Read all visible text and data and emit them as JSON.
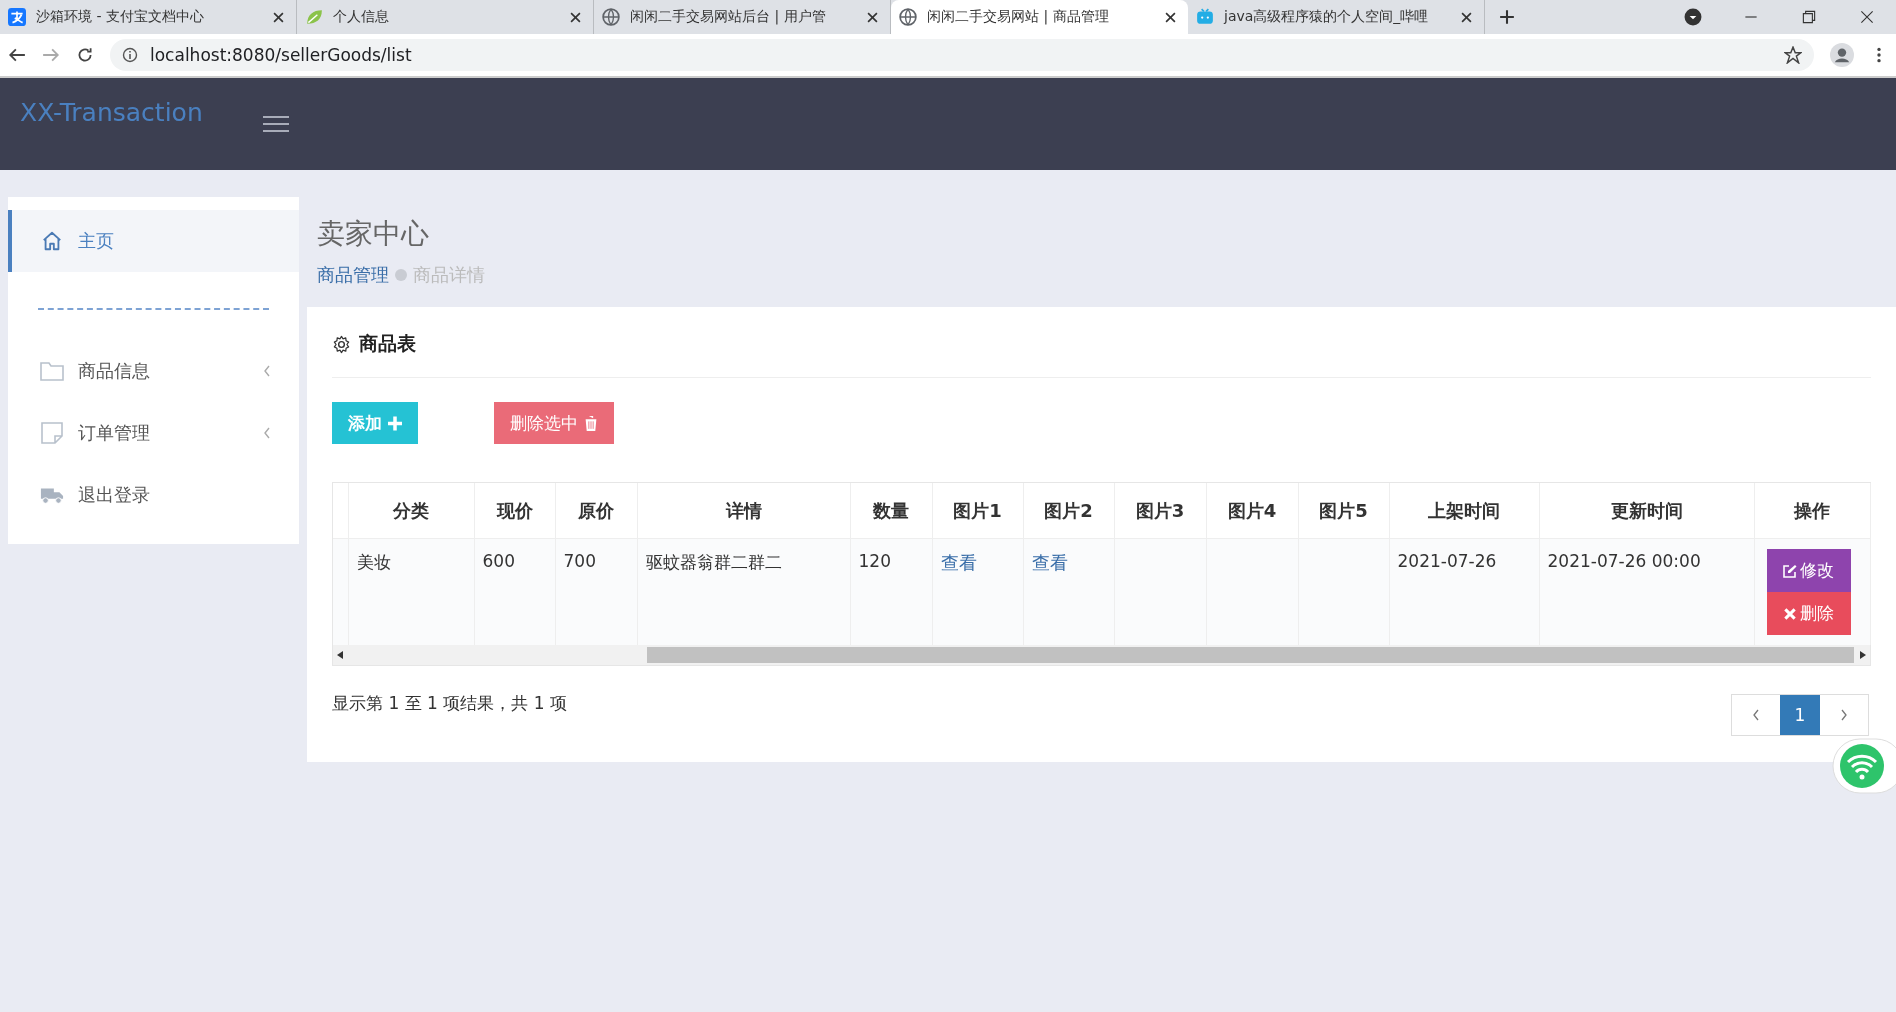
{
  "browser": {
    "tabs": [
      {
        "title": "沙箱环境 - 支付宝文档中心",
        "selected": false
      },
      {
        "title": "个人信息",
        "selected": false
      },
      {
        "title": "闲闲二手交易网站后台 | 用户管",
        "selected": false
      },
      {
        "title": "闲闲二手交易网站 | 商品管理",
        "selected": true
      },
      {
        "title": "java高级程序猿的个人空间_哔哩",
        "selected": false
      }
    ],
    "address": "localhost:8080/sellerGoods/list"
  },
  "app": {
    "brand": "XX-Transaction"
  },
  "sidebar": {
    "items": [
      {
        "label": "主页",
        "kind": "link",
        "selected": true
      },
      {
        "kind": "divider"
      },
      {
        "label": "商品信息",
        "kind": "menu",
        "expanded": false,
        "selected": false
      },
      {
        "label": "订单管理",
        "kind": "menu",
        "expanded": false,
        "selected": false
      },
      {
        "label": "退出登录",
        "kind": "link",
        "selected": false
      }
    ]
  },
  "page": {
    "title": "卖家中心",
    "breadcrumb": [
      {
        "label": "商品管理",
        "kind": "link"
      },
      {
        "label": "商品详情",
        "kind": "current"
      }
    ]
  },
  "card": {
    "title": "商品表",
    "buttons": [
      {
        "label": "添加",
        "kind": "add"
      },
      {
        "label": "删除选中",
        "kind": "delete"
      }
    ],
    "table": {
      "columns": [
        "分类",
        "现价",
        "原价",
        "详情",
        "数量",
        "图片1",
        "图片2",
        "图片3",
        "图片4",
        "图片5",
        "上架时间",
        "更新时间",
        "操作"
      ],
      "rows": [
        {
          "cells": [
            {
              "kind": "text",
              "text": "美妆"
            },
            {
              "kind": "text",
              "text": "600"
            },
            {
              "kind": "text",
              "text": "700"
            },
            {
              "kind": "text",
              "text": "驱蚊器翁群二群二"
            },
            {
              "kind": "text",
              "text": "120"
            },
            {
              "kind": "link",
              "text": "查看"
            },
            {
              "kind": "link",
              "text": "查看"
            },
            {
              "kind": "empty"
            },
            {
              "kind": "empty"
            },
            {
              "kind": "empty"
            },
            {
              "kind": "text",
              "text": "2021-07-26"
            },
            {
              "kind": "text",
              "text": "2021-07-26 00:00"
            },
            {
              "kind": "actions",
              "actions": [
                {
                  "label": "修改",
                  "kind": "edit"
                },
                {
                  "label": "删除",
                  "kind": "delete"
                }
              ]
            }
          ]
        }
      ]
    },
    "summary": "显示第 1 至 1 项结果，共 1 项",
    "pagination": {
      "pages": [
        {
          "label": "1",
          "selected": true
        }
      ]
    }
  }
}
